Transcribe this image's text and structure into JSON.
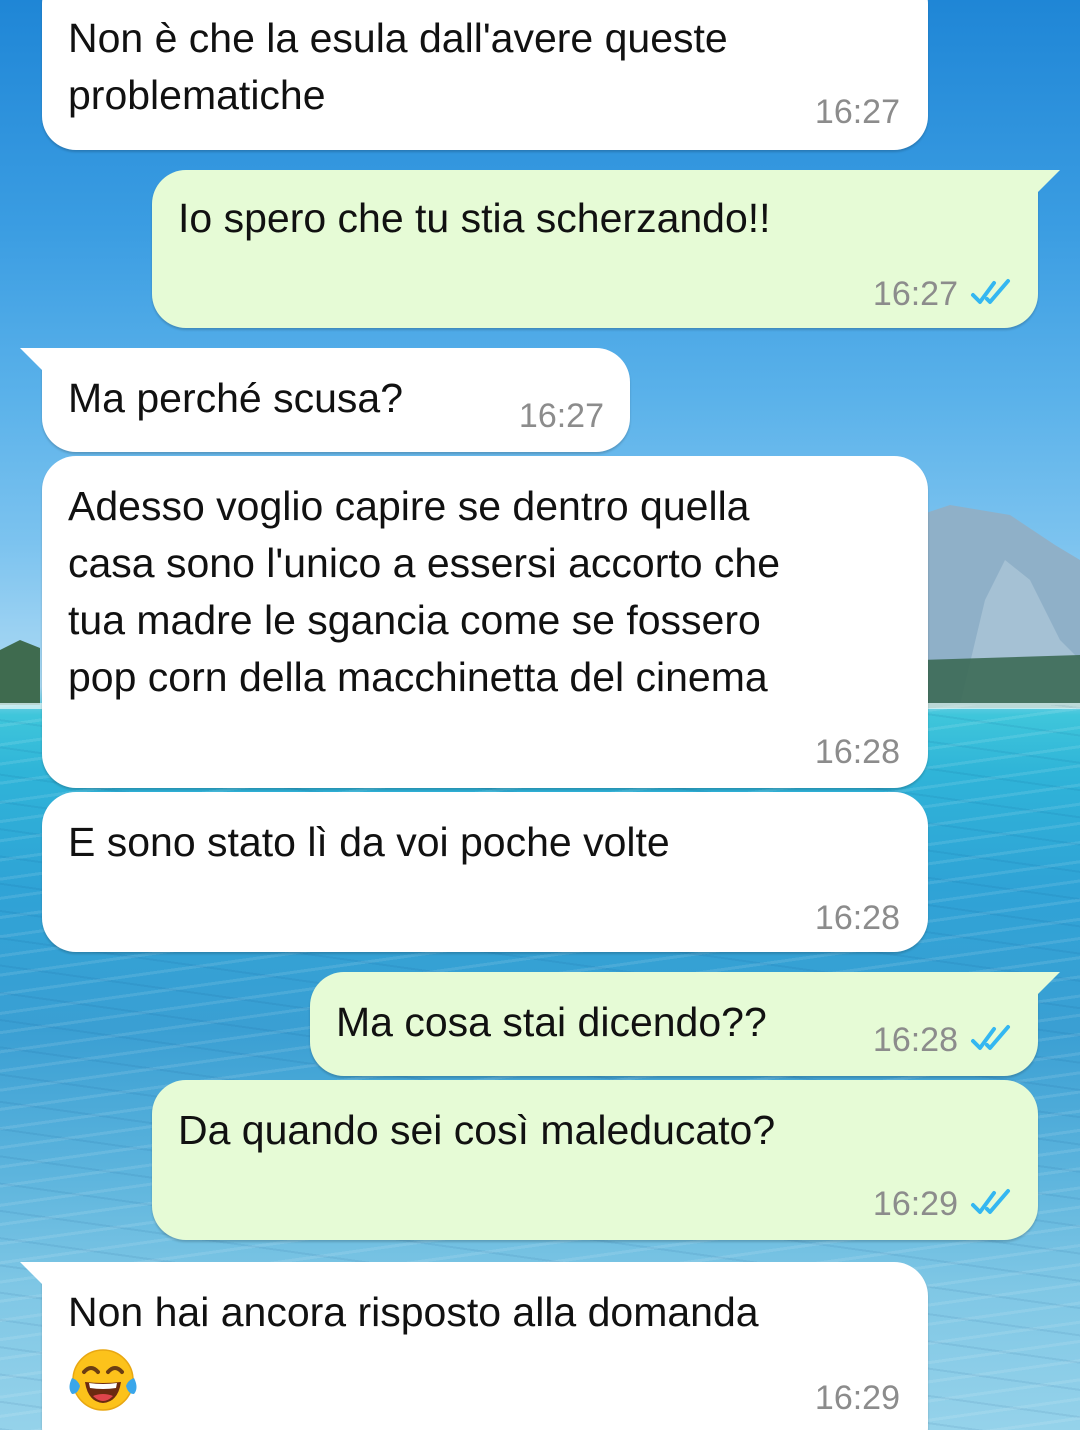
{
  "chat": {
    "messages": [
      {
        "direction": "in",
        "text": "Non è che la esula dall'avere queste\nproblematiche",
        "time": "16:27"
      },
      {
        "direction": "out",
        "text": "Io spero che tu stia scherzando!!",
        "time": "16:27",
        "status": "read"
      },
      {
        "direction": "in",
        "text": "Ma perché scusa?",
        "time": "16:27"
      },
      {
        "direction": "in",
        "text": "Adesso voglio capire se dentro quella\ncasa sono l'unico a essersi accorto che\ntua madre le sgancia come se fossero\npop corn della macchinetta del cinema",
        "time": "16:28"
      },
      {
        "direction": "in",
        "text": "E sono stato lì da voi poche volte",
        "time": "16:28"
      },
      {
        "direction": "out",
        "text": "Ma cosa stai dicendo??",
        "time": "16:28",
        "status": "read"
      },
      {
        "direction": "out",
        "text": "Da quando sei così maleducato?",
        "time": "16:29",
        "status": "read"
      },
      {
        "direction": "in",
        "text": "Non hai ancora risposto alla domanda",
        "time": "16:29",
        "emoji": "face-with-tears-of-joy"
      }
    ]
  },
  "colors": {
    "incoming_bubble": "#ffffff",
    "outgoing_bubble": "#e6fbd6",
    "read_ticks": "#34b7f1",
    "timestamp": "#8c8c8c"
  },
  "icons": {
    "read_receipt": "double-check-icon",
    "emoji": "face-with-tears-of-joy-icon"
  },
  "background": "sea-and-mountain-wallpaper"
}
